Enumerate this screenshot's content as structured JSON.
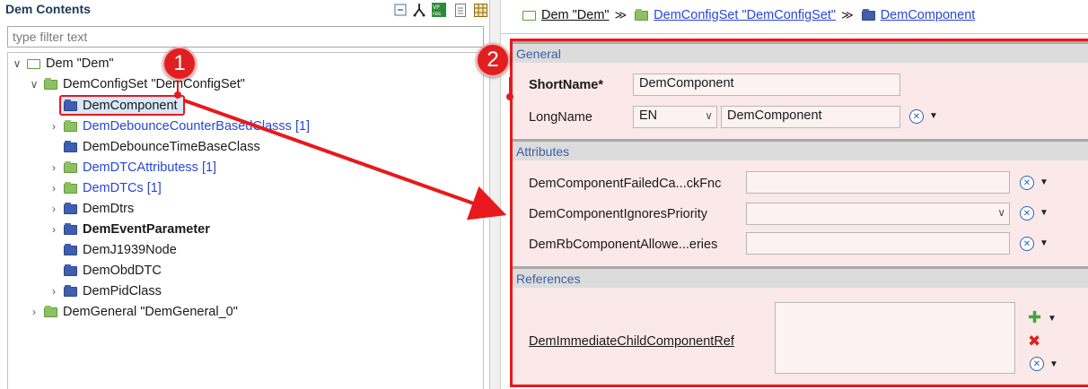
{
  "left_panel": {
    "title": "Dem Contents",
    "filter_placeholder": "type filter text",
    "toolbar_icons": [
      "collapse-all-icon",
      "link-icon",
      "vp-res-icon",
      "document-icon",
      "grid-icon"
    ],
    "tree": [
      {
        "label": "Dem \"Dem\"",
        "chevron": "v",
        "folder": "outline"
      },
      {
        "label": "DemConfigSet \"DemConfigSet\"",
        "chevron": "v",
        "folder": "green"
      },
      {
        "label": "DemComponent",
        "chevron": "",
        "folder": "blue",
        "selected": true
      },
      {
        "label": "DemDebounceCounterBasedClasss [1]",
        "chevron": ">",
        "folder": "green",
        "style": "link"
      },
      {
        "label": "DemDebounceTimeBaseClass",
        "chevron": "",
        "folder": "blue"
      },
      {
        "label": "DemDTCAttributess [1]",
        "chevron": ">",
        "folder": "green",
        "style": "link"
      },
      {
        "label": "DemDTCs [1]",
        "chevron": ">",
        "folder": "green",
        "style": "link"
      },
      {
        "label": "DemDtrs",
        "chevron": ">",
        "folder": "blue"
      },
      {
        "label": "DemEventParameter",
        "chevron": ">",
        "folder": "blue",
        "style": "bold"
      },
      {
        "label": "DemJ1939Node",
        "chevron": "",
        "folder": "blue"
      },
      {
        "label": "DemObdDTC",
        "chevron": "",
        "folder": "blue"
      },
      {
        "label": "DemPidClass",
        "chevron": ">",
        "folder": "blue"
      },
      {
        "label": "DemGeneral \"DemGeneral_0\"",
        "chevron": ">",
        "folder": "green"
      }
    ]
  },
  "breadcrumb": {
    "items": [
      "Dem \"Dem\"",
      "DemConfigSet \"DemConfigSet\"",
      "DemComponent"
    ],
    "separator": "≫"
  },
  "editor": {
    "general": {
      "heading": "General",
      "short_name_label": "ShortName*",
      "short_name_value": "DemComponent",
      "long_name_label": "LongName",
      "long_name_lang": "EN",
      "long_name_value": "DemComponent"
    },
    "attributes": {
      "heading": "Attributes",
      "fields": [
        {
          "label": "DemComponentFailedCa...ckFnc",
          "value": ""
        },
        {
          "label": "DemComponentIgnoresPriority",
          "value": ""
        },
        {
          "label": "DemRbComponentAllowe...eries",
          "value": ""
        }
      ]
    },
    "references": {
      "heading": "References",
      "ref_label": "DemImmediateChildComponentRef"
    }
  },
  "annotations": {
    "badge_1": "1",
    "badge_2": "2",
    "accent_color": "#e8191c"
  }
}
